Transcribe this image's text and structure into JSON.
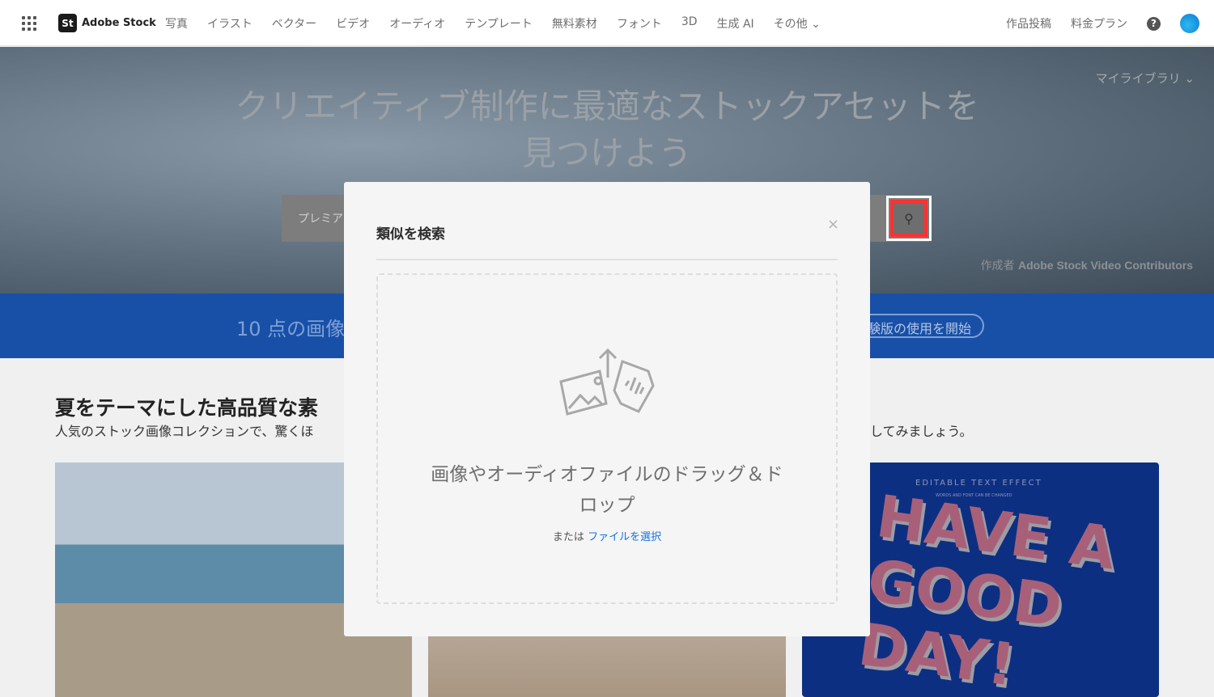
{
  "nav": {
    "brand": "Adobe Stock",
    "brand_mark": "St",
    "items": [
      "写真",
      "イラスト",
      "ベクター",
      "ビデオ",
      "オーディオ",
      "テンプレート",
      "無料素材",
      "フォント",
      "3D",
      "生成 AI",
      "その他 ⌄"
    ],
    "contribute": "作品投稿",
    "pricing": "料金プラン",
    "help": "?"
  },
  "hero": {
    "title": "クリエイティブ制作に最適なストックアセットを見つけよう",
    "my_library": "マイライブラリ ⌄",
    "search_placeholder": "プレミア",
    "credit_prefix": "作成者",
    "credit_name": "Adobe Stock Video Contributors"
  },
  "banner": {
    "text": "10 点の画像",
    "button": "験版の使用を開始"
  },
  "section": {
    "title": "夏をテーマにした高品質な素",
    "subtitle": "人気のストック画像コレクションで、驚くほ",
    "subtitle_tail": "してみましょう。"
  },
  "card3": {
    "effect": "EDITABLE TEXT EFFECT",
    "sub": "WORDS AND FONT CAN BE CHANGED",
    "art": "HAVE A GOOD DAY!"
  },
  "modal": {
    "title": "類似を検索",
    "close": "×",
    "drop_text": "画像やオーディオファイルのドラッグ＆ドロップ",
    "or": "または",
    "select_file": "ファイルを選択"
  },
  "colors": {
    "accent": "#1473e6",
    "highlight": "#ff3131"
  }
}
